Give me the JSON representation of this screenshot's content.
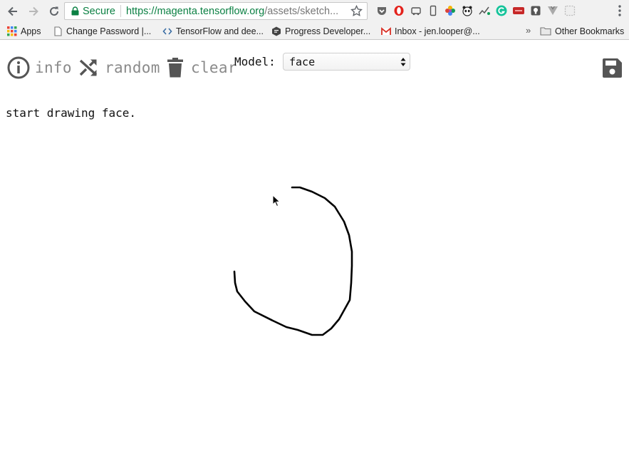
{
  "browser": {
    "address": {
      "secure_label": "Secure",
      "url_host": "https://magenta.tensorflow.org",
      "url_path": "/assets/sketch..."
    },
    "bookmarks": [
      {
        "label": "Apps"
      },
      {
        "label": "Change Password |..."
      },
      {
        "label": "TensorFlow and dee..."
      },
      {
        "label": "Progress Developer..."
      },
      {
        "label": "Inbox - jen.looper@..."
      }
    ],
    "overflow_label": "»",
    "other_bookmarks": "Other Bookmarks"
  },
  "toolbar": {
    "info_label": "info",
    "random_label": "random",
    "clear_label": "clear",
    "model_label": "Model:",
    "model_selected": "face"
  },
  "status": {
    "message": "start drawing face."
  },
  "colors": {
    "secure_green": "#0b8043",
    "tool_grey": "#8a8a8a",
    "icon_dark": "#555555",
    "stroke": "#000000"
  }
}
